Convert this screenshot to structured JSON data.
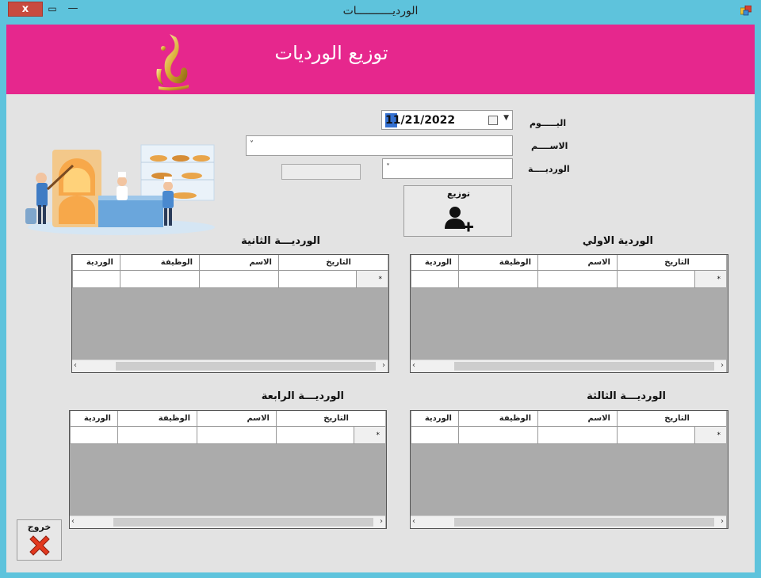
{
  "window": {
    "title": "الورديـــــــــــات",
    "close_label": "x",
    "restore_label": "▭",
    "minimize_label": "—"
  },
  "header": {
    "title": "توزيع الورديات",
    "background": "#e6278d"
  },
  "form": {
    "day_label": "اليـــــوم",
    "name_label": "الاســــم",
    "shift_label": "الورديــــة",
    "date_value": "11/21/2022",
    "distribute_label": "توزيع"
  },
  "grids": [
    {
      "title": "الوردية الاولي",
      "columns": [
        "التاريخ",
        "الاسم",
        "الوظيفة",
        "الوردية"
      ],
      "new_row_marker": "*"
    },
    {
      "title": "الورديـــة الثانية",
      "columns": [
        "التاريخ",
        "الاسم",
        "الوظيفة",
        "الوردية"
      ],
      "new_row_marker": "*"
    },
    {
      "title": "الورديـــة الثالثة",
      "columns": [
        "التاريخ",
        "الاسم",
        "الوظيفة",
        "الوردية"
      ],
      "new_row_marker": "*"
    },
    {
      "title": "الورديـــة الرابعة",
      "columns": [
        "التاريخ",
        "الاسم",
        "الوظيفة",
        "الوردية"
      ],
      "new_row_marker": "*"
    }
  ],
  "exit": {
    "label": "خروج"
  },
  "colors": {
    "titlebar": "#5ec3dc",
    "close": "#c84b3f",
    "header": "#e6278d",
    "client": "#e3e3e3",
    "grid_body": "#ababab"
  }
}
